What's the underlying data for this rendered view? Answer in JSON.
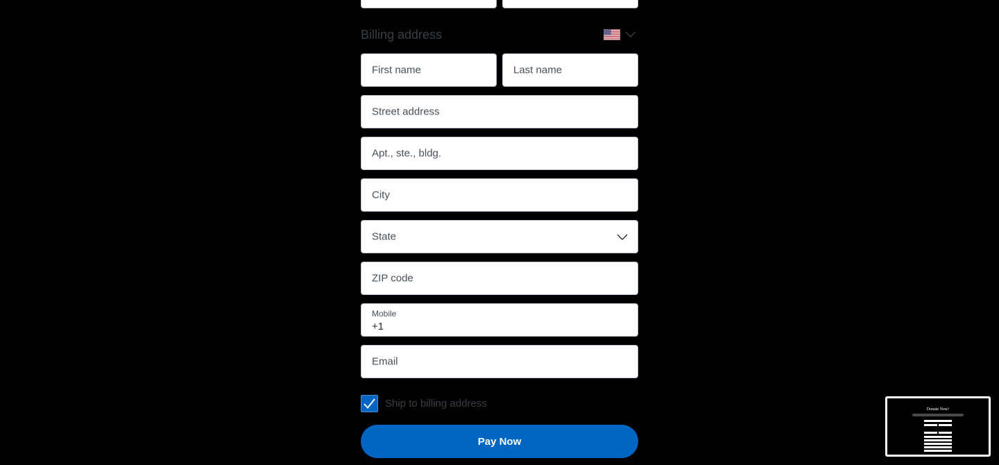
{
  "billing": {
    "title": "Billing address",
    "country_flag": "us-flag-icon",
    "fields": {
      "first_name": "First name",
      "last_name": "Last name",
      "street": "Street address",
      "apt": "Apt., ste., bldg.",
      "city": "City",
      "state": "State",
      "zip": "ZIP code",
      "mobile_label": "Mobile",
      "mobile_value": "+1",
      "email": "Email"
    }
  },
  "ship_checkbox": {
    "label": "Ship to billing address",
    "checked": true
  },
  "pay_button": {
    "label": "Pay Now"
  },
  "preview_thumbnail": {
    "title": "Donate Now!"
  },
  "colors": {
    "background": "#000000",
    "accent": "#0065c3",
    "field_bg": "#ffffff"
  }
}
